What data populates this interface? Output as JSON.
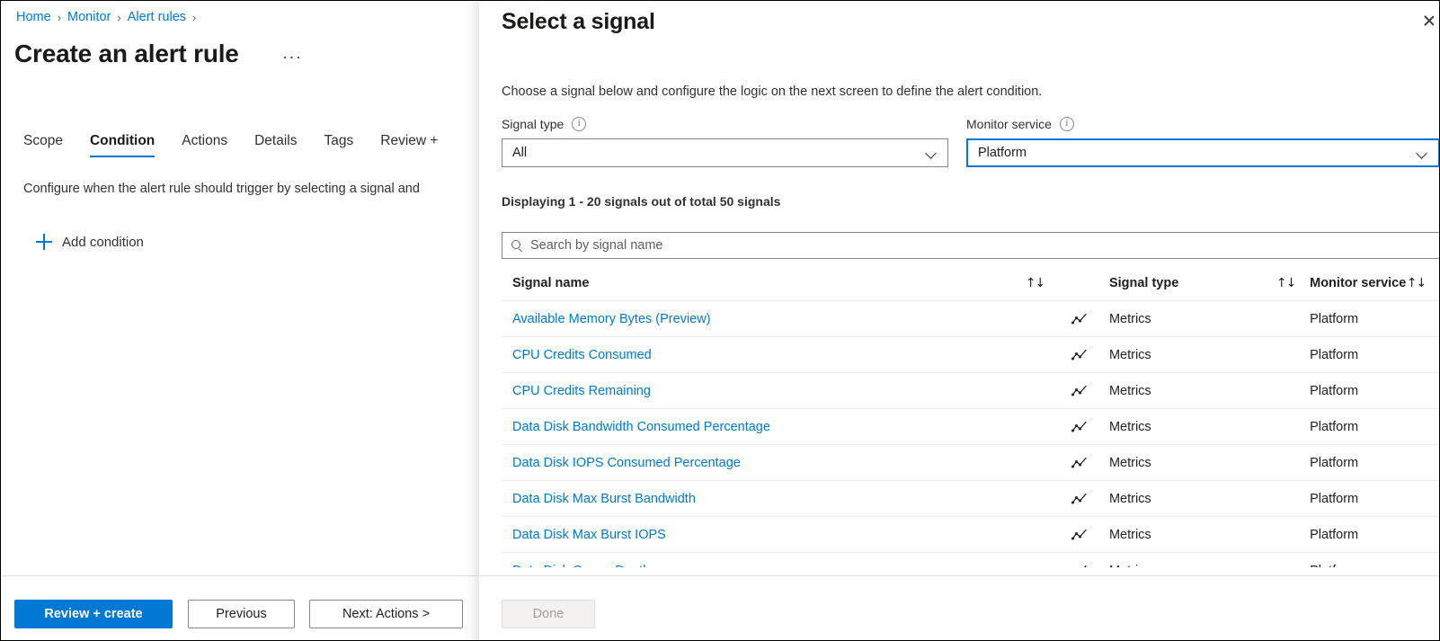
{
  "left": {
    "breadcrumb": [
      {
        "label": "Home",
        "sep": "›"
      },
      {
        "label": "Monitor",
        "sep": "›"
      },
      {
        "label": "Alert rules",
        "sep": "›"
      }
    ],
    "page_title": "Create an alert rule",
    "title_menu": "···",
    "tabs": [
      {
        "label": "Scope",
        "active": false
      },
      {
        "label": "Condition",
        "active": true
      },
      {
        "label": "Actions",
        "active": false
      },
      {
        "label": "Details",
        "active": false
      },
      {
        "label": "Tags",
        "active": false
      },
      {
        "label": "Review +",
        "active": false
      }
    ],
    "tab_description": "Configure when the alert rule should trigger by selecting a signal and",
    "add_condition_label": "Add condition",
    "footer": {
      "review_create": "Review + create",
      "previous": "Previous",
      "next": "Next: Actions >"
    }
  },
  "flyout": {
    "title": "Select a signal",
    "description": "Choose a signal below and configure the logic on the next screen to define the alert condition.",
    "signal_type": {
      "label": "Signal type",
      "value": "All"
    },
    "monitor_service": {
      "label": "Monitor service",
      "value": "Platform"
    },
    "displaying": "Displaying 1 - 20 signals out of total 50 signals",
    "search": {
      "value": "",
      "placeholder": "Search by signal name"
    },
    "table": {
      "columns": [
        {
          "key": "name",
          "label": "Signal name"
        },
        {
          "key": "type",
          "label": "Signal type"
        },
        {
          "key": "service",
          "label": "Monitor service"
        }
      ],
      "sort_icon": "↑↓",
      "rows": [
        {
          "name": "Available Memory Bytes (Preview)",
          "type": "Metrics",
          "service": "Platform",
          "icon": "metrics-line-chart-icon"
        },
        {
          "name": "CPU Credits Consumed",
          "type": "Metrics",
          "service": "Platform",
          "icon": "metrics-line-chart-icon"
        },
        {
          "name": "CPU Credits Remaining",
          "type": "Metrics",
          "service": "Platform",
          "icon": "metrics-line-chart-icon"
        },
        {
          "name": "Data Disk Bandwidth Consumed Percentage",
          "type": "Metrics",
          "service": "Platform",
          "icon": "metrics-line-chart-icon"
        },
        {
          "name": "Data Disk IOPS Consumed Percentage",
          "type": "Metrics",
          "service": "Platform",
          "icon": "metrics-line-chart-icon"
        },
        {
          "name": "Data Disk Max Burst Bandwidth",
          "type": "Metrics",
          "service": "Platform",
          "icon": "metrics-line-chart-icon"
        },
        {
          "name": "Data Disk Max Burst IOPS",
          "type": "Metrics",
          "service": "Platform",
          "icon": "metrics-line-chart-icon"
        },
        {
          "name": "Data Disk Queue Depth",
          "type": "Metrics",
          "service": "Platform",
          "icon": "metrics-line-chart-icon"
        }
      ]
    },
    "footer": {
      "done": "Done"
    }
  },
  "colors": {
    "accent": "#0078d4",
    "link": "#0078d4",
    "text": "#201f1e",
    "border": "#8a8886",
    "row_divider": "#edebe9",
    "disabled_text": "#a19f9d",
    "disabled_bg": "#f3f2f1"
  }
}
